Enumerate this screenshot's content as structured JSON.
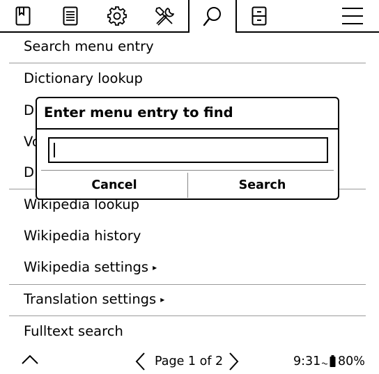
{
  "tabs": [
    {
      "icon": "bookmark-icon"
    },
    {
      "icon": "document-list-icon"
    },
    {
      "icon": "gear-icon"
    },
    {
      "icon": "tools-icon"
    },
    {
      "icon": "search-icon",
      "active": true
    },
    {
      "icon": "filing-cabinet-icon"
    },
    {
      "icon": "hamburger-menu-icon"
    }
  ],
  "menu": {
    "items": [
      {
        "label": "Search menu entry"
      },
      {
        "label": "Dictionary lookup"
      },
      {
        "label": "D"
      },
      {
        "label": "Vo"
      },
      {
        "label": "D"
      },
      {
        "label": "Wikipedia lookup"
      },
      {
        "label": "Wikipedia history"
      },
      {
        "label": "Wikipedia settings",
        "submenu_arrow": "▸"
      },
      {
        "label": "Translation settings",
        "submenu_arrow": "▸"
      },
      {
        "label": "Fulltext search"
      }
    ]
  },
  "footer": {
    "page_label": "Page 1 of 2",
    "time": "9:31",
    "battery": "80%"
  },
  "dialog": {
    "title": "Enter menu entry to find",
    "input_value": "",
    "cancel_label": "Cancel",
    "search_label": "Search"
  }
}
